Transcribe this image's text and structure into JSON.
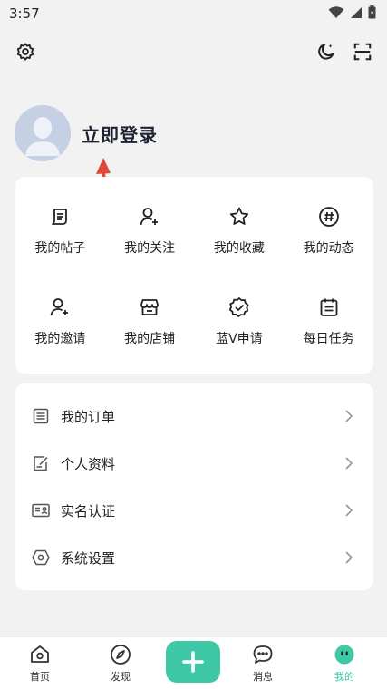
{
  "status_bar": {
    "time": "3:57"
  },
  "profile": {
    "login_text": "立即登录"
  },
  "grid": [
    {
      "label": "我的帖子",
      "icon": "post-icon"
    },
    {
      "label": "我的关注",
      "icon": "follow-user-icon"
    },
    {
      "label": "我的收藏",
      "icon": "star-icon"
    },
    {
      "label": "我的动态",
      "icon": "hashtag-icon"
    },
    {
      "label": "我的邀请",
      "icon": "invite-user-icon"
    },
    {
      "label": "我的店铺",
      "icon": "store-icon"
    },
    {
      "label": "蓝V申请",
      "icon": "verified-badge-icon"
    },
    {
      "label": "每日任务",
      "icon": "calendar-task-icon"
    }
  ],
  "list": [
    {
      "label": "我的订单",
      "icon": "order-icon"
    },
    {
      "label": "个人资料",
      "icon": "edit-profile-icon"
    },
    {
      "label": "实名认证",
      "icon": "id-card-icon"
    },
    {
      "label": "系统设置",
      "icon": "settings-hex-icon"
    }
  ],
  "bottom_nav": {
    "home": "首页",
    "discover": "发现",
    "messages": "消息",
    "mine": "我的"
  },
  "colors": {
    "accent": "#3ec8a6",
    "arrow": "#e0483a"
  }
}
